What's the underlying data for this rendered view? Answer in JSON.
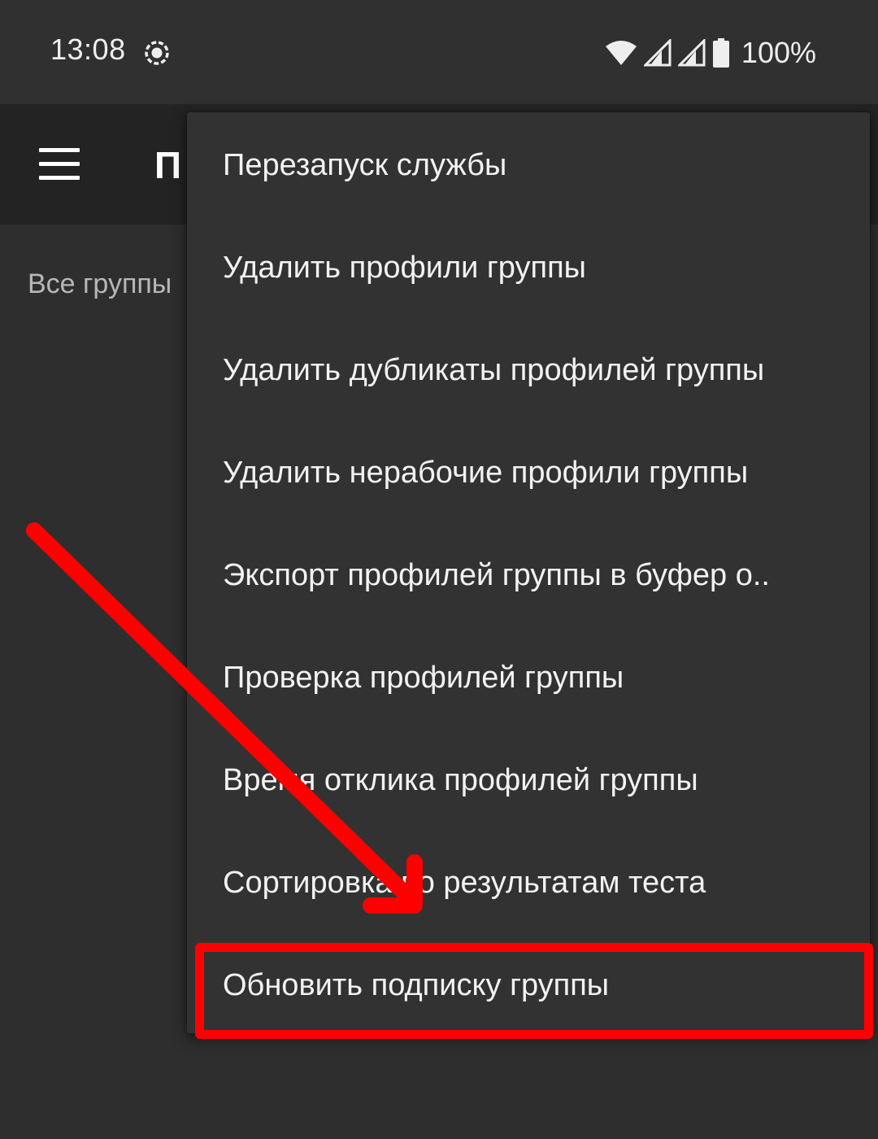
{
  "status_bar": {
    "time": "13:08",
    "battery_percent": "100%",
    "icons": [
      "screen-record-icon",
      "wifi-icon",
      "signal-icon",
      "signal-icon",
      "battery-icon"
    ]
  },
  "toolbar": {
    "title": "П"
  },
  "group_tab": {
    "label": "Все группы"
  },
  "menu": {
    "items": [
      {
        "label": "Перезапуск службы"
      },
      {
        "label": "Удалить профили группы"
      },
      {
        "label": "Удалить дубликаты профилей группы"
      },
      {
        "label": "Удалить нерабочие профили группы"
      },
      {
        "label": "Экспорт профилей группы в буфер о.."
      },
      {
        "label": "Проверка профилей группы"
      },
      {
        "label": "Время отклика профилей группы"
      },
      {
        "label": "Сортировка по результатам теста"
      },
      {
        "label": "Обновить подписку группы"
      }
    ]
  },
  "annotation": {
    "color": "#ff0000",
    "highlighted_item": "Обновить подписку группы"
  }
}
